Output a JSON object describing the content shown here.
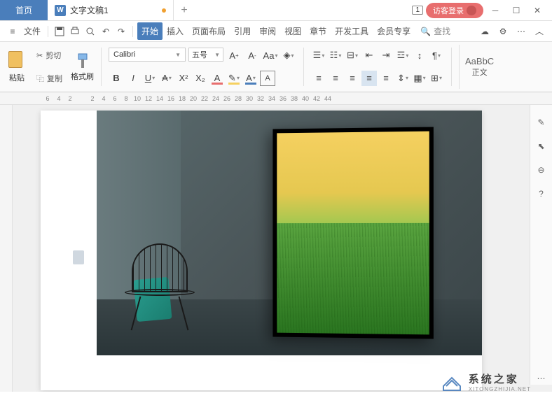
{
  "titlebar": {
    "home_tab": "首页",
    "doc_tab": "文字文稿1",
    "window_count": "1",
    "login": "访客登录"
  },
  "menubar": {
    "file": "文件",
    "tabs": [
      "开始",
      "插入",
      "页面布局",
      "引用",
      "审阅",
      "视图",
      "章节",
      "开发工具",
      "会员专享"
    ],
    "active_tab": 0,
    "search": "查找"
  },
  "ribbon": {
    "paste": "粘贴",
    "cut": "剪切",
    "copy": "复制",
    "format_painter": "格式刷",
    "font_name": "Calibri",
    "font_size": "五号",
    "style_preview": "AaBbC",
    "style_name": "正文"
  },
  "ruler": {
    "ticks": [
      "6",
      "4",
      "2",
      "",
      "2",
      "4",
      "6",
      "8",
      "10",
      "12",
      "14",
      "16",
      "18",
      "20",
      "22",
      "24",
      "26",
      "28",
      "30",
      "32",
      "34",
      "36",
      "38",
      "40",
      "42",
      "44"
    ]
  },
  "watermark": {
    "cn": "系统之家",
    "en": "XITONGZHIJIA.NET"
  }
}
